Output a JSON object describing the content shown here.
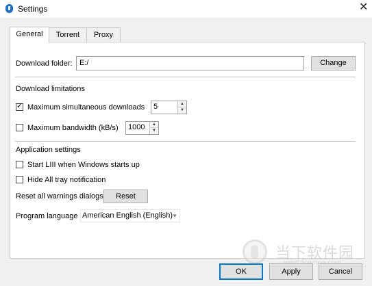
{
  "window": {
    "title": "Settings",
    "close_glyph": "✕"
  },
  "tabs": [
    {
      "label": "General",
      "active": true
    },
    {
      "label": "Torrent",
      "active": false
    },
    {
      "label": "Proxy",
      "active": false
    }
  ],
  "download_folder": {
    "label": "Download folder:",
    "value": "E:/",
    "change_label": "Change"
  },
  "download_limits": {
    "heading": "Download limitations",
    "max_downloads": {
      "checked": true,
      "label": "Maximum simultaneous downloads",
      "value": "5"
    },
    "max_bandwidth": {
      "checked": false,
      "label": "Maximum bandwidth (kB/s)",
      "value": "1000"
    }
  },
  "app_settings": {
    "heading": "Application settings",
    "start_with_windows": {
      "checked": false,
      "label": "Start LIII when Windows starts up"
    },
    "hide_tray": {
      "checked": false,
      "label": "Hide All tray notification"
    },
    "reset_warnings": {
      "label": "Reset all warnings dialogs",
      "button": "Reset"
    },
    "language": {
      "label": "Program language",
      "value": "American English (English)"
    }
  },
  "footer": {
    "ok": "OK",
    "apply": "Apply",
    "cancel": "Cancel"
  },
  "watermark": {
    "text": "当下软件园",
    "url": "www.downxia.com"
  },
  "colors": {
    "accent": "#0078d7",
    "dialog_bg": "#f0f0f0",
    "panel_bg": "#ffffff"
  },
  "icons": {
    "app": "info-app-icon",
    "close": "close-icon",
    "spin_up": "spin-up-arrow-icon",
    "spin_down": "spin-down-arrow-icon",
    "dropdown": "chevron-down-icon"
  }
}
